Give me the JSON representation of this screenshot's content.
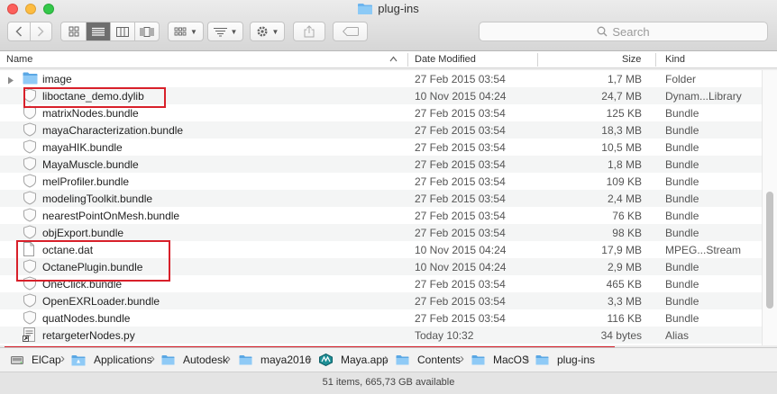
{
  "window": {
    "title": "plug-ins"
  },
  "toolbar": {
    "search_placeholder": "Search"
  },
  "columns": {
    "name": "Name",
    "date": "Date Modified",
    "size": "Size",
    "kind": "Kind"
  },
  "rows": [
    {
      "name": "image",
      "date": "27 Feb 2015 03:54",
      "size": "1,7 MB",
      "kind": "Folder",
      "icon": "folder-icon"
    },
    {
      "name": "liboctane_demo.dylib",
      "date": "10 Nov 2015 04:24",
      "size": "24,7 MB",
      "kind": "Dynam...Library",
      "icon": "bundle-icon"
    },
    {
      "name": "matrixNodes.bundle",
      "date": "27 Feb 2015 03:54",
      "size": "125 KB",
      "kind": "Bundle",
      "icon": "bundle-icon"
    },
    {
      "name": "mayaCharacterization.bundle",
      "date": "27 Feb 2015 03:54",
      "size": "18,3 MB",
      "kind": "Bundle",
      "icon": "bundle-icon"
    },
    {
      "name": "mayaHIK.bundle",
      "date": "27 Feb 2015 03:54",
      "size": "10,5 MB",
      "kind": "Bundle",
      "icon": "bundle-icon"
    },
    {
      "name": "MayaMuscle.bundle",
      "date": "27 Feb 2015 03:54",
      "size": "1,8 MB",
      "kind": "Bundle",
      "icon": "bundle-icon"
    },
    {
      "name": "melProfiler.bundle",
      "date": "27 Feb 2015 03:54",
      "size": "109 KB",
      "kind": "Bundle",
      "icon": "bundle-icon"
    },
    {
      "name": "modelingToolkit.bundle",
      "date": "27 Feb 2015 03:54",
      "size": "2,4 MB",
      "kind": "Bundle",
      "icon": "bundle-icon"
    },
    {
      "name": "nearestPointOnMesh.bundle",
      "date": "27 Feb 2015 03:54",
      "size": "76 KB",
      "kind": "Bundle",
      "icon": "bundle-icon"
    },
    {
      "name": "objExport.bundle",
      "date": "27 Feb 2015 03:54",
      "size": "98 KB",
      "kind": "Bundle",
      "icon": "bundle-icon"
    },
    {
      "name": "octane.dat",
      "date": "10 Nov 2015 04:24",
      "size": "17,9 MB",
      "kind": "MPEG...Stream",
      "icon": "document-icon"
    },
    {
      "name": "OctanePlugin.bundle",
      "date": "10 Nov 2015 04:24",
      "size": "2,9 MB",
      "kind": "Bundle",
      "icon": "bundle-icon"
    },
    {
      "name": "OneClick.bundle",
      "date": "27 Feb 2015 03:54",
      "size": "465 KB",
      "kind": "Bundle",
      "icon": "bundle-icon"
    },
    {
      "name": "OpenEXRLoader.bundle",
      "date": "27 Feb 2015 03:54",
      "size": "3,3 MB",
      "kind": "Bundle",
      "icon": "bundle-icon"
    },
    {
      "name": "quatNodes.bundle",
      "date": "27 Feb 2015 03:54",
      "size": "116 KB",
      "kind": "Bundle",
      "icon": "bundle-icon"
    },
    {
      "name": "retargeterNodes.py",
      "date": "Today 10:32",
      "size": "34 bytes",
      "kind": "Alias",
      "icon": "script-alias-icon"
    }
  ],
  "path": [
    "ElCap",
    "Applications",
    "Autodesk",
    "maya2016",
    "Maya.app",
    "Contents",
    "MacOS",
    "plug-ins"
  ],
  "status": {
    "text": "51 items, 665,73 GB available"
  },
  "colors": {
    "highlight": "#d8202a",
    "folder": "#6cb4ee",
    "active_segment": "#6e6e6e"
  }
}
